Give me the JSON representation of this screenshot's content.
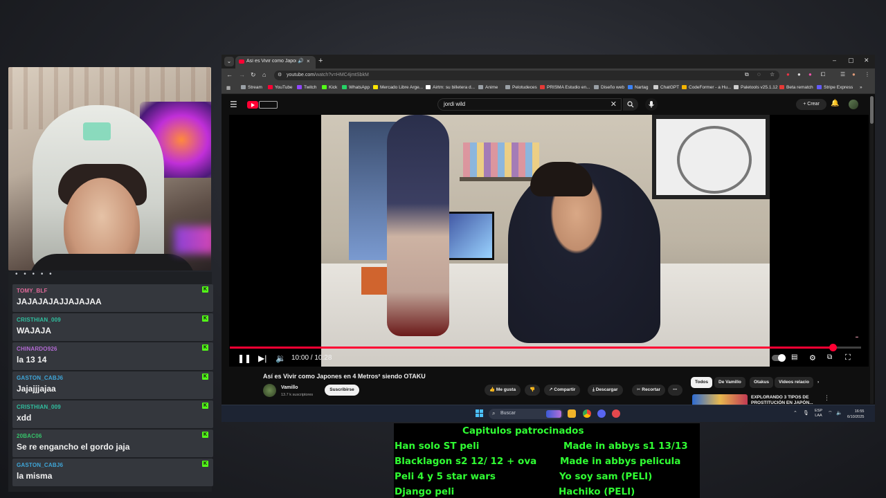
{
  "chat": {
    "messages": [
      {
        "user": "TOMY_BLF",
        "text": "JAJAJAJAJJAJAJAA",
        "color": "#e36a9a"
      },
      {
        "user": "CRISTHIAN_009",
        "text": "WAJAJA",
        "color": "#30c0a0"
      },
      {
        "user": "CHINARDO926",
        "text": "la 13 14",
        "color": "#b36ad4"
      },
      {
        "user": "GASTON_CABJ6",
        "text": "Jajajjjajaa",
        "color": "#3fa6d8"
      },
      {
        "user": "CRISTHIAN_009",
        "text": "xdd",
        "color": "#30c0a0"
      },
      {
        "user": "20BAC06",
        "text": "Se re engancho el gordo jaja",
        "color": "#36c46b"
      },
      {
        "user": "GASTON_CABJ6",
        "text": "la misma",
        "color": "#3fa6d8"
      }
    ],
    "badge_icon": "kick-badge-icon",
    "badge_letter": "K"
  },
  "browser": {
    "tab": {
      "title": "Así es Vivir como Japones e",
      "icon": "youtube-favicon"
    },
    "url_host": "youtube.com",
    "url_path": "/watch?v=HMC4jmtSbkM",
    "bookmarks": [
      "Stream",
      "YouTube",
      "Twitch",
      "Kick",
      "WhatsApp",
      "Mercado Libre Arge...",
      "Airtm: su billetera d...",
      "Anime",
      "Pelotudeces",
      "PRISMA Estudio en...",
      "Diseño web",
      "Nartag",
      "ChatGPT",
      "CodeFormer - a Hu...",
      "Paletools v25.1.12",
      "Beta rematch",
      "Stripe Express"
    ]
  },
  "youtube": {
    "search_value": "jordi wild",
    "create_label": "Crear",
    "video": {
      "title": "Así es Vivir como Japones en 4 Metros² siendo OTAKU",
      "time_current": "10:00",
      "time_total": "10:28",
      "time_display": "10:00 / 10:28",
      "progress_fraction": 0.955
    },
    "channel": {
      "name": "Vamillo",
      "subscribers": "13.7 k suscriptores"
    },
    "subscribe_label": "Suscribirse",
    "actions": {
      "like": "Me gusta",
      "share": "Compartir",
      "download": "Descargar",
      "clip": "Recortar"
    },
    "chips": [
      "Todos",
      "De Vamillo",
      "Otakus",
      "Videos relacio"
    ],
    "recommendation_title": "EXPLORANDO 3 TIPOS DE PROSTITUCIÓN EN JAPÓN..."
  },
  "taskbar": {
    "search_placeholder": "Buscar",
    "lang_top": "ESP",
    "lang_bottom": "LAA",
    "time": "16:55",
    "date": "6/10/2025"
  },
  "sponsor": {
    "heading": "Capitulos patrocinados",
    "left": [
      "Han solo ST peli",
      "Blacklagon s2 12/ 12 + ova",
      "Peli 4  y 5 star wars",
      "Django peli"
    ],
    "right": [
      "Made in abbys s1 13/13",
      "Made in abbys pelicula",
      "Yo soy sam (PELI)",
      "Hachiko (PELI)"
    ],
    "color": "#30ff33"
  }
}
